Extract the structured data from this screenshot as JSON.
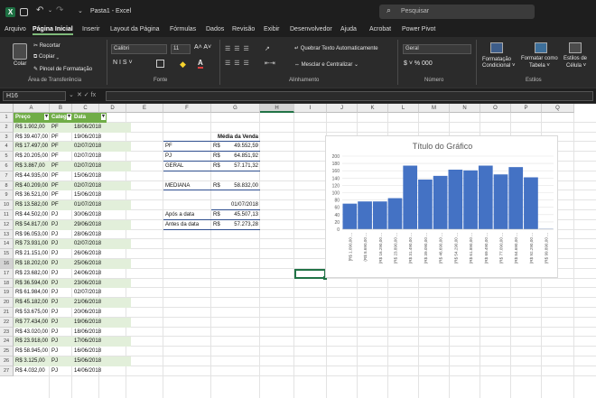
{
  "window": {
    "title": "Pasta1 - Excel",
    "search_placeholder": "Pesquisar"
  },
  "tabs": [
    "Arquivo",
    "Página Inicial",
    "Inserir",
    "Layout da Página",
    "Fórmulas",
    "Dados",
    "Revisão",
    "Exibir",
    "Desenvolvedor",
    "Ajuda",
    "Acrobat",
    "Power Pivot"
  ],
  "ribbon": {
    "colar": "Colar",
    "recortar": "Recortar",
    "copiar": "Copiar",
    "pincel": "Pincel de Formatação",
    "grupo_transferencia": "Área de Transferência",
    "fonte_nome": "Calibri",
    "fonte_tamanho": "11",
    "aumentar_diminuir": "A˄ A˅",
    "estilos_fonte": "N  I  S ˅",
    "grupo_fonte": "Fonte",
    "quebrar_texto": "Quebrar Texto Automaticamente",
    "mesclar": "Mesclar e Centralizar",
    "grupo_alinhamento": "Alinhamento",
    "formato_numero": "Geral",
    "numero_botoes": "$ ˅  %  000",
    "grupo_numero": "Número",
    "formatacao_condicional": "Formatação",
    "condicional": "Condicional ˅",
    "formatar_como": "Formatar como",
    "tabela": "Tabela ˅",
    "estilos_de": "Estilos de",
    "celula": "Célula ˅",
    "grupo_estilos": "Estilos"
  },
  "formula_bar": {
    "name_box": "H16",
    "fx_label": "✕  ✓  fx"
  },
  "columns": [
    "A",
    "B",
    "C",
    "D",
    "E",
    "F",
    "G",
    "H",
    "I",
    "J",
    "K",
    "L",
    "M",
    "N",
    "O",
    "P",
    "Q"
  ],
  "rows": [
    "1",
    "2",
    "3",
    "4",
    "5",
    "6",
    "7",
    "8",
    "9",
    "10",
    "11",
    "12",
    "13",
    "14",
    "15",
    "16",
    "17",
    "18",
    "19",
    "20",
    "21",
    "22",
    "23",
    "24",
    "25",
    "26",
    "27"
  ],
  "table": {
    "headers": [
      "Preço",
      "Categoria",
      "Data"
    ],
    "rows": [
      [
        "R$ 1.902,00",
        "PF",
        "18/06/2018"
      ],
      [
        "R$ 39.407,00",
        "PF",
        "19/06/2018"
      ],
      [
        "R$ 17.497,00",
        "PF",
        "02/07/2018"
      ],
      [
        "R$ 20.205,00",
        "PF",
        "02/07/2018"
      ],
      [
        "R$ 3.867,00",
        "PF",
        "02/07/2018"
      ],
      [
        "R$ 44.935,00",
        "PF",
        "15/06/2018"
      ],
      [
        "R$ 40.209,00",
        "PF",
        "02/07/2018"
      ],
      [
        "R$ 36.521,00",
        "PF",
        "15/06/2018"
      ],
      [
        "R$ 13.582,00",
        "PF",
        "01/07/2018"
      ],
      [
        "R$ 44.502,00",
        "PJ",
        "30/06/2018"
      ],
      [
        "R$ 54.817,00",
        "PJ",
        "29/06/2018"
      ],
      [
        "R$ 96.053,00",
        "PJ",
        "28/06/2018"
      ],
      [
        "R$ 73.931,00",
        "PJ",
        "02/07/2018"
      ],
      [
        "R$ 21.151,00",
        "PJ",
        "26/06/2018"
      ],
      [
        "R$ 18.202,00",
        "PJ",
        "25/06/2018"
      ],
      [
        "R$ 23.682,00",
        "PJ",
        "24/06/2018"
      ],
      [
        "R$ 36.594,00",
        "PJ",
        "23/06/2018"
      ],
      [
        "R$ 61.984,00",
        "PJ",
        "02/07/2018"
      ],
      [
        "R$ 45.182,00",
        "PJ",
        "21/06/2018"
      ],
      [
        "R$ 53.675,00",
        "PJ",
        "20/06/2018"
      ],
      [
        "R$ 77.434,00",
        "PJ",
        "19/06/2018"
      ],
      [
        "R$ 43.020,00",
        "PJ",
        "18/06/2018"
      ],
      [
        "R$ 23.918,00",
        "PJ",
        "17/06/2018"
      ],
      [
        "R$ 58.945,00",
        "PJ",
        "16/06/2018"
      ],
      [
        "R$ 3.125,00",
        "PJ",
        "15/06/2018"
      ],
      [
        "R$ 4.032,00",
        "PJ",
        "14/06/2018"
      ]
    ]
  },
  "summary": {
    "header": "Média da Venda",
    "pf_label": "PF",
    "pf_cur": "R$",
    "pf_value": "49.552,59",
    "pj_label": "PJ",
    "pj_cur": "R$",
    "pj_value": "64.851,92",
    "geral_label": "GERAL",
    "geral_cur": "R$",
    "geral_value": "57.171,32",
    "mediana_label": "MEDIANA",
    "mediana_cur": "R$",
    "mediana_value": "58.832,00",
    "date_value": "01/07/2018",
    "apos_label": "Após a data",
    "apos_cur": "R$",
    "apos_value": "45.507,13",
    "antes_label": "Antes da data",
    "antes_cur": "R$",
    "antes_value": "57.273,28"
  },
  "chart_data": {
    "type": "bar",
    "title": "Título do Gráfico",
    "categories": [
      "[R$ 1.090,00 ...",
      "(R$ 8.690,00 ...",
      "(R$ 16.290,00 ...",
      "(R$ 23.890,00 ...",
      "(R$ 31.490,00 ...",
      "(R$ 39.090,00 ...",
      "(R$ 46.690,00 ...",
      "(R$ 54.290,00 ...",
      "(R$ 61.890,00 ...",
      "(R$ 69.490,00 ...",
      "(R$ 77.090,00 ...",
      "(R$ 84.690,00 ...",
      "(R$ 92.290,00 ...",
      "(R$ 99.890,00 ..."
    ],
    "values": [
      70,
      76,
      76,
      85,
      174,
      136,
      146,
      163,
      161,
      174,
      150,
      170,
      142,
      1
    ],
    "yticks": [
      "0",
      "20",
      "40",
      "60",
      "80",
      "100",
      "120",
      "140",
      "160",
      "180",
      "200"
    ],
    "ylim": [
      0,
      200
    ],
    "bar_color": "#4472c4",
    "grid": true
  }
}
